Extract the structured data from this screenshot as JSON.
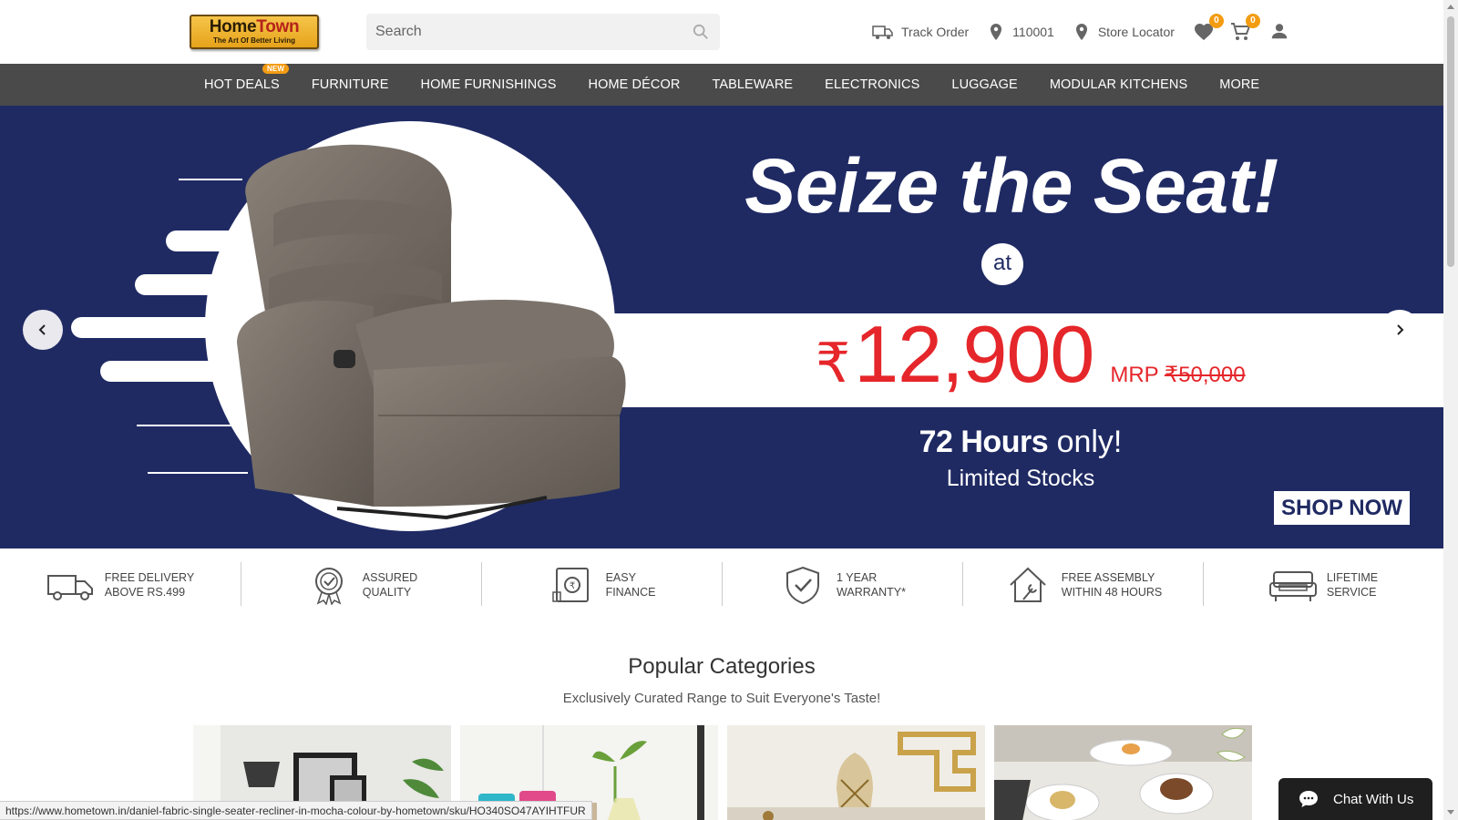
{
  "header": {
    "logo": {
      "line1_a": "Home",
      "line1_b": "Town",
      "line2": "The Art Of Better Living"
    },
    "search": {
      "placeholder": "Search"
    },
    "track_order": "Track Order",
    "pincode": "110001",
    "store_locator": "Store Locator",
    "wishlist_count": "0",
    "cart_count": "0"
  },
  "nav": {
    "items": [
      "HOT DEALS",
      "FURNITURE",
      "HOME FURNISHINGS",
      "HOME DÉCOR",
      "TABLEWARE",
      "ELECTRONICS",
      "LUGGAGE",
      "MODULAR KITCHENS",
      "MORE"
    ],
    "new_badge": "NEW"
  },
  "hero": {
    "title": "Seize the Seat!",
    "at": "at",
    "currency": "₹",
    "price": "12,900",
    "mrp_label": "MRP",
    "mrp_value": "₹50,000",
    "hours_bold": "72 Hours",
    "hours_rest": "only!",
    "limited": "Limited Stocks",
    "cta": "SHOP NOW"
  },
  "features": [
    {
      "icon": "truck-icon",
      "text": "FREE DELIVERY\nABOVE RS.499"
    },
    {
      "icon": "badge-icon",
      "text": "ASSURED\nQUALITY"
    },
    {
      "icon": "finance-icon",
      "text": "EASY\nFINANCE"
    },
    {
      "icon": "shield-check-icon",
      "text": "1 YEAR\nWARRANTY*"
    },
    {
      "icon": "wrench-house-icon",
      "text": "FREE ASSEMBLY\nWITHIN 48 HOURS"
    },
    {
      "icon": "sofa-icon",
      "text": "LIFETIME\nSERVICE"
    }
  ],
  "popular": {
    "title": "Popular Categories",
    "subtitle": "Exclusively Curated Range to Suit Everyone's Taste!"
  },
  "status_url": "https://www.hometown.in/daniel-fabric-single-seater-recliner-in-mocha-colour-by-hometown/sku/HO340SO47AYIHTFUR",
  "chat": "Chat With Us",
  "colors": {
    "nav_bg": "#4a4a4a",
    "hero_bg": "#1f2a63",
    "price_red": "#e5262a",
    "accent_orange": "#f39c12"
  }
}
